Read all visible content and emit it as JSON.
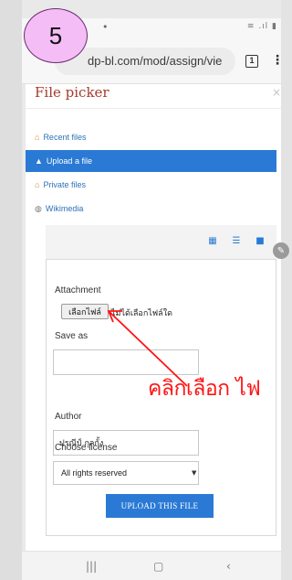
{
  "step_badge": "5",
  "browser": {
    "url": "dp-bl.com/mod/assign/vie",
    "tab_count": "1",
    "menu_icon": "kebab-menu-icon"
  },
  "file_picker": {
    "title": "File picker",
    "close": "×",
    "nav": [
      {
        "label": "Recent files",
        "icon": "recent-files-icon"
      },
      {
        "label": "Upload a file",
        "icon": "upload-icon",
        "active": true
      },
      {
        "label": "Private files",
        "icon": "private-files-icon"
      },
      {
        "label": "Wikimedia",
        "icon": "wikimedia-icon"
      }
    ],
    "view_modes": [
      "grid-view-icon",
      "list-view-icon",
      "folder-view-icon"
    ]
  },
  "form": {
    "attachment_label": "Attachment",
    "choose_file_button": "เลือกไฟล์",
    "no_file_text": "ไม่ได้เลือกไฟล์ใด",
    "save_as_label": "Save as",
    "save_as_value": "",
    "author_label": "Author",
    "author_value": "ปรณีป์ กุลกั้ง",
    "license_label": "Choose license",
    "license_value": "All rights reserved",
    "upload_button": "UPLOAD THIS FILE"
  },
  "annotation": {
    "text": "คลิกเลือก ไฟ",
    "color": "#ff1414"
  },
  "colors": {
    "accent": "#2a7ad5",
    "title": "#a53c2e",
    "badge": "#f4bdf6"
  }
}
